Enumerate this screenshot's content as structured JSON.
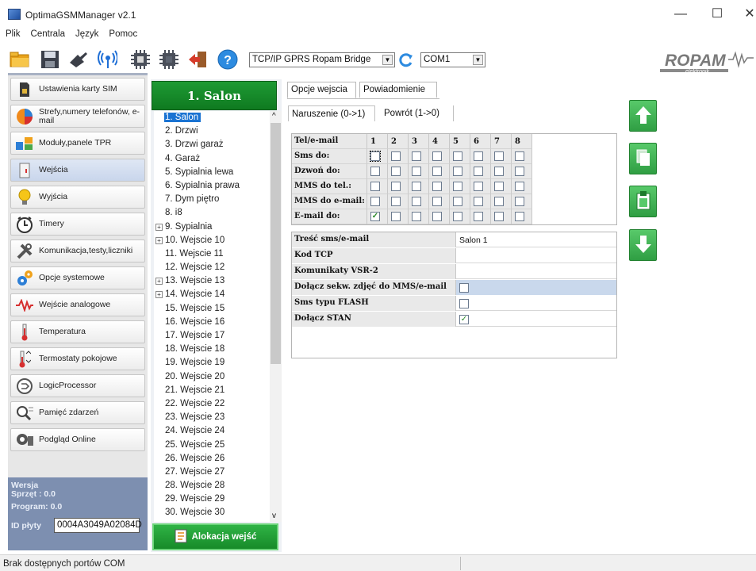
{
  "window": {
    "title": "OptimaGSMManager v2.1",
    "minimize": "—",
    "maximize": "☐",
    "close": "✕"
  },
  "menu": [
    "Plik",
    "Centrala",
    "Język",
    "Pomoc"
  ],
  "toolbar": {
    "icons": [
      "open-folder-icon",
      "save-icon",
      "connect-icon",
      "antenna-icon",
      "chip-read-icon",
      "chip-write-icon",
      "exit-icon",
      "help-icon"
    ],
    "help_glyph": "?",
    "connection_type": "TCP/IP GPRS Ropam Bridge",
    "port": "COM1",
    "logo_text": "ROPAM",
    "logo_sub": "elektronik"
  },
  "sidebar": {
    "items": [
      {
        "label": "Ustawienia karty SIM",
        "icon": "sim-card-icon"
      },
      {
        "label": "Strefy,numery telefonów, e-mail",
        "icon": "zones-pie-icon"
      },
      {
        "label": "Moduły,panele TPR",
        "icon": "modules-icon"
      },
      {
        "label": "Wejścia",
        "icon": "inputs-icon",
        "active": true
      },
      {
        "label": "Wyjścia",
        "icon": "bulb-icon"
      },
      {
        "label": "Timery",
        "icon": "clock-icon"
      },
      {
        "label": "Komunikacja,testy,liczniki",
        "icon": "tools-icon"
      },
      {
        "label": "Opcje systemowe",
        "icon": "gears-icon"
      },
      {
        "label": "Wejście analogowe",
        "icon": "waveform-icon"
      },
      {
        "label": "Temperatura",
        "icon": "thermometer-icon"
      },
      {
        "label": "Termostaty pokojowe",
        "icon": "thermostat-icon"
      },
      {
        "label": "LogicProcessor",
        "icon": "logic-icon"
      },
      {
        "label": "Pamięć zdarzeń",
        "icon": "event-log-icon"
      },
      {
        "label": "Podgląd Online",
        "icon": "online-preview-icon"
      }
    ],
    "version": {
      "group_label": "Wersja",
      "hardware_label": "Sprzęt : 0.0",
      "program_label": "Program: 0.0",
      "board_id_label": "ID płyty",
      "board_id_value": "0004A3049A02084D"
    }
  },
  "inputs_panel": {
    "header": "1. Salon",
    "items": [
      {
        "label": "1. Salon",
        "selected": true
      },
      {
        "label": "2. Drzwi"
      },
      {
        "label": "3. Drzwi garaż"
      },
      {
        "label": "4. Garaż"
      },
      {
        "label": "5. Sypialnia lewa"
      },
      {
        "label": "6. Sypialnia prawa"
      },
      {
        "label": "7. Dym piętro"
      },
      {
        "label": "8. i8"
      },
      {
        "label": "9. Sypialnia",
        "expandable": true
      },
      {
        "label": "10. Wejscie 10",
        "expandable": true
      },
      {
        "label": "11. Wejscie 11"
      },
      {
        "label": "12. Wejscie 12"
      },
      {
        "label": "13. Wejscie 13",
        "expandable": true
      },
      {
        "label": "14. Wejscie 14",
        "expandable": true
      },
      {
        "label": "15. Wejscie 15"
      },
      {
        "label": "16. Wejscie 16"
      },
      {
        "label": "17. Wejscie 17"
      },
      {
        "label": "18. Wejscie 18"
      },
      {
        "label": "19. Wejscie 19"
      },
      {
        "label": "20. Wejscie 20"
      },
      {
        "label": "21. Wejscie 21"
      },
      {
        "label": "22. Wejscie 22"
      },
      {
        "label": "23. Wejscie 23"
      },
      {
        "label": "24. Wejscie 24"
      },
      {
        "label": "25. Wejscie 25"
      },
      {
        "label": "26. Wejscie 26"
      },
      {
        "label": "27. Wejscie 27"
      },
      {
        "label": "28. Wejscie 28"
      },
      {
        "label": "29. Wejscie 29"
      },
      {
        "label": "30. Wejscie 30"
      }
    ],
    "scroll_up": "^",
    "scroll_down": "v",
    "allocation_button": "Alokacja wejść"
  },
  "tabs": {
    "items": [
      "Opcje wejscia",
      "Powiadomienie"
    ],
    "active": 1
  },
  "subtabs": {
    "items": [
      "Naruszenie (0->1)",
      "Powrót (1->0)"
    ],
    "active": 0
  },
  "matrix": {
    "header_label": "Tel/e-mail",
    "columns": [
      "1",
      "2",
      "3",
      "4",
      "5",
      "6",
      "7",
      "8"
    ],
    "rows": [
      {
        "label": "Sms do:",
        "checked": [
          false,
          false,
          false,
          false,
          false,
          false,
          false,
          false
        ]
      },
      {
        "label": "Dzwoń do:",
        "checked": [
          false,
          false,
          false,
          false,
          false,
          false,
          false,
          false
        ]
      },
      {
        "label": "MMS do tel.:",
        "checked": [
          false,
          false,
          false,
          false,
          false,
          false,
          false,
          false
        ]
      },
      {
        "label": "MMS do e-mail:",
        "checked": [
          false,
          false,
          false,
          false,
          false,
          false,
          false,
          false
        ]
      },
      {
        "label": "E-mail do:",
        "checked": [
          true,
          false,
          false,
          false,
          false,
          false,
          false,
          false
        ]
      }
    ]
  },
  "properties": {
    "rows": [
      {
        "label": "Treść sms/e-mail",
        "value": "Salon 1",
        "type": "text"
      },
      {
        "label": "Kod TCP",
        "value": "",
        "type": "text"
      },
      {
        "label": "Komunikaty VSR-2",
        "value": "",
        "type": "text"
      },
      {
        "label": "Dołącz sekw. zdjęć do MMS/e-mail",
        "checked": false,
        "type": "checkbox",
        "highlight": true
      },
      {
        "label": "Sms typu FLASH",
        "checked": false,
        "type": "checkbox"
      },
      {
        "label": "Dołącz STAN",
        "checked": true,
        "type": "checkbox"
      }
    ]
  },
  "right_buttons": [
    "move-up-icon",
    "copy-icon",
    "paste-icon",
    "move-down-icon"
  ],
  "status": {
    "text": "Brak dostępnych portów COM"
  },
  "check_glyph": "✓"
}
